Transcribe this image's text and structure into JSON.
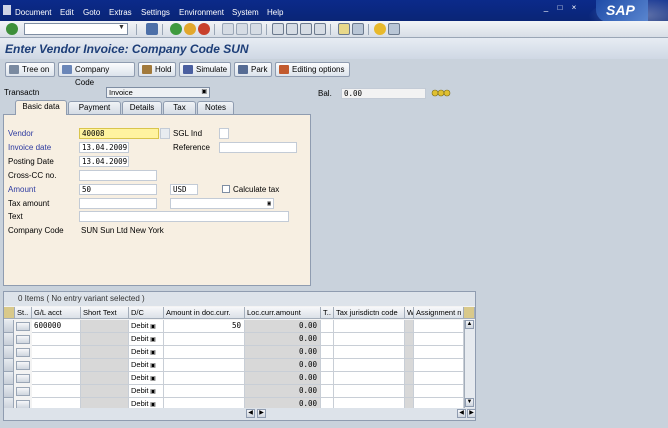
{
  "menu": {
    "items": [
      "Document",
      "Edit",
      "Goto",
      "Extras",
      "Settings",
      "Environment",
      "System",
      "Help"
    ],
    "logo": "SAP"
  },
  "title": "Enter Vendor Invoice: Company Code SUN",
  "app_toolbar": {
    "tree_on": "Tree on",
    "company_code": "Company Code",
    "hold": "Hold",
    "simulate": "Simulate",
    "park": "Park",
    "editing_options": "Editing options"
  },
  "header": {
    "transactn_label": "Transactn",
    "transactn_value": "Invoice",
    "bal_label": "Bal.",
    "bal_value": "0.00"
  },
  "tabs": [
    "Basic data",
    "Payment",
    "Details",
    "Tax",
    "Notes"
  ],
  "form": {
    "vendor_label": "Vendor",
    "vendor_value": "40008",
    "sgl_label": "SGL Ind",
    "invoice_date_label": "Invoice date",
    "invoice_date_value": "13.04.2009",
    "reference_label": "Reference",
    "posting_date_label": "Posting Date",
    "posting_date_value": "13.04.2009",
    "crosscc_label": "Cross-CC no.",
    "amount_label": "Amount",
    "amount_value": "50",
    "currency_value": "USD",
    "calc_tax_label": "Calculate tax",
    "tax_amount_label": "Tax amount",
    "text_label": "Text",
    "company_code_label": "Company Code",
    "company_code_value": "SUN Sun Ltd New York"
  },
  "grid": {
    "title": "0 Items ( No entry variant selected )",
    "columns": [
      "St..",
      "G/L acct",
      "Short Text",
      "D/C",
      "Amount in doc.curr.",
      "Loc.curr.amount",
      "T..",
      "Tax jurisdictn code",
      "W..",
      "Assignment n"
    ],
    "rows": [
      {
        "gl": "600000",
        "dc": "Debit",
        "amount": "50",
        "loc": "0.00"
      },
      {
        "gl": "",
        "dc": "Debit",
        "amount": "",
        "loc": "0.00"
      },
      {
        "gl": "",
        "dc": "Debit",
        "amount": "",
        "loc": "0.00"
      },
      {
        "gl": "",
        "dc": "Debit",
        "amount": "",
        "loc": "0.00"
      },
      {
        "gl": "",
        "dc": "Debit",
        "amount": "",
        "loc": "0.00"
      },
      {
        "gl": "",
        "dc": "Debit",
        "amount": "",
        "loc": "0.00"
      },
      {
        "gl": "",
        "dc": "Debit",
        "amount": "",
        "loc": "0.00"
      }
    ]
  }
}
